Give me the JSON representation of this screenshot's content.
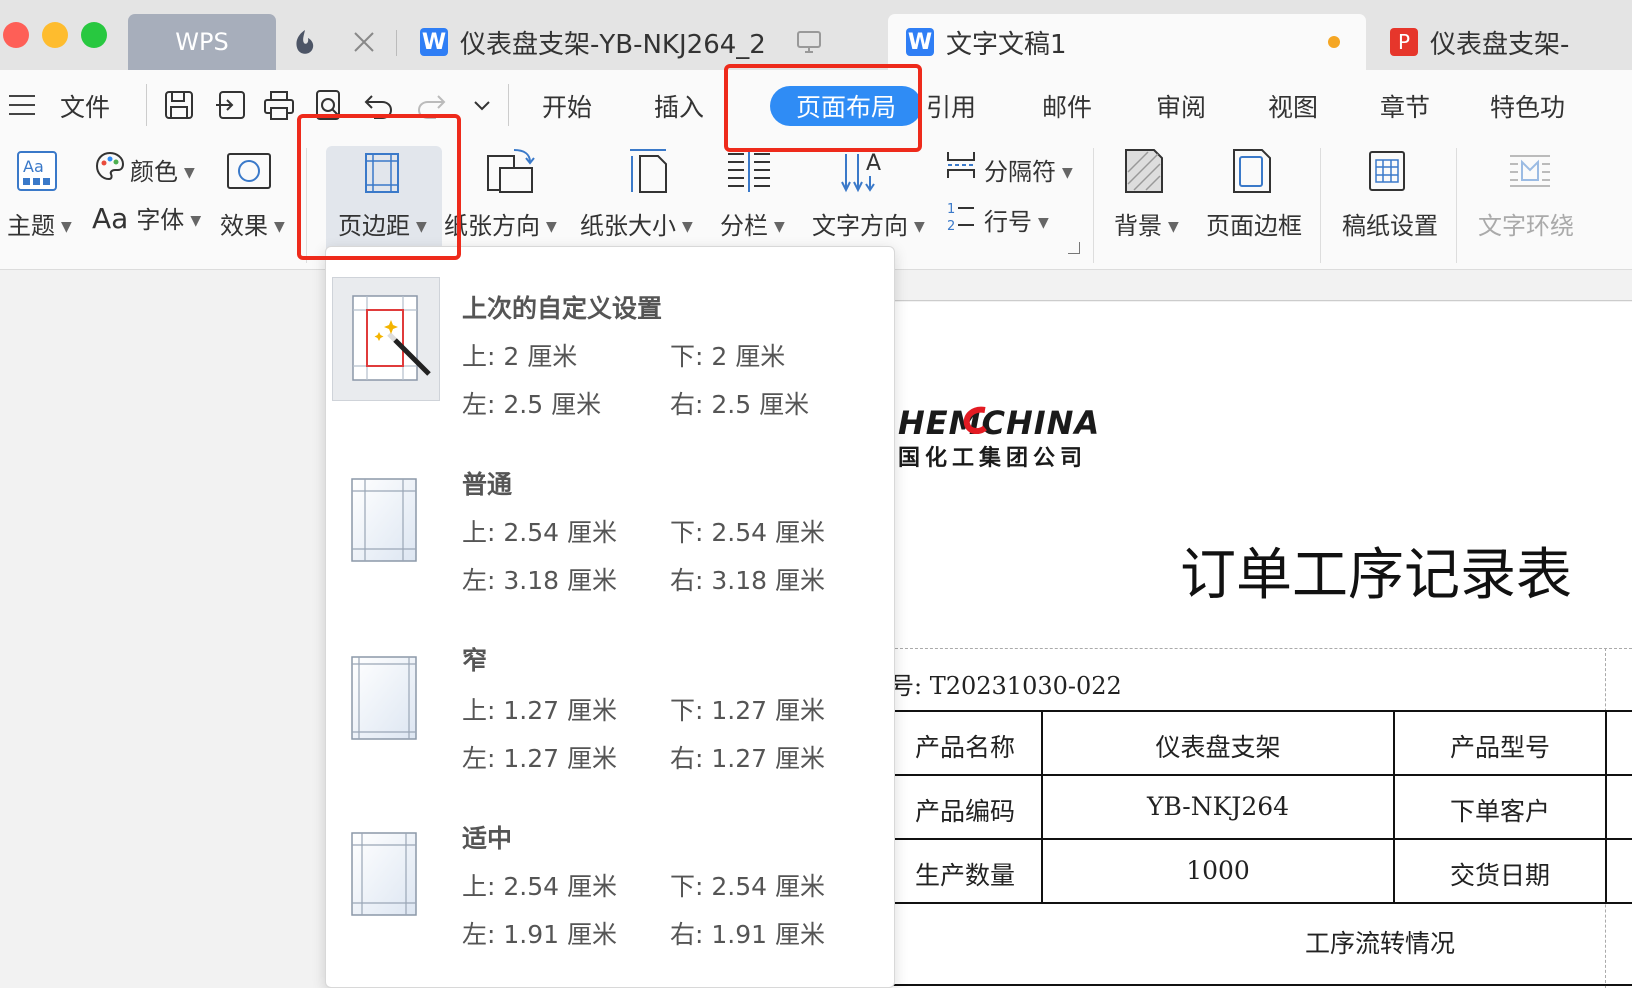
{
  "tabs": {
    "wps_label": "WPS",
    "doc1_title": "仪表盘支架-YB-NKJ264_2",
    "doc2_title": "文字文稿1",
    "doc3_title": "仪表盘支架-"
  },
  "menu": {
    "file_label": "文件",
    "items": [
      "开始",
      "插入",
      "页面布局",
      "引用",
      "邮件",
      "审阅",
      "视图",
      "章节",
      "特色功"
    ]
  },
  "ribbon": {
    "theme": "主题",
    "color": "颜色",
    "font": "字体",
    "font_prefix": "Aa",
    "effect": "效果",
    "margin": "页边距",
    "orientation": "纸张方向",
    "size": "纸张大小",
    "columns": "分栏",
    "text_direction": "文字方向",
    "separator": "分隔符",
    "line_number": "行号",
    "background": "背景",
    "page_border": "页面边框",
    "manuscript": "稿纸设置",
    "text_wrap": "文字环绕"
  },
  "margin_options": [
    {
      "name": "上次的自定义设置",
      "top": "上: 2 厘米",
      "bottom": "下: 2 厘米",
      "left": "左: 2.5 厘米",
      "right": "右: 2.5 厘米"
    },
    {
      "name": "普通",
      "top": "上: 2.54 厘米",
      "bottom": "下: 2.54 厘米",
      "left": "左: 3.18 厘米",
      "right": "右: 3.18 厘米"
    },
    {
      "name": "窄",
      "top": "上: 1.27 厘米",
      "bottom": "下: 1.27 厘米",
      "left": "左: 1.27 厘米",
      "right": "右: 1.27 厘米"
    },
    {
      "name": "适中",
      "top": "上: 2.54 厘米",
      "bottom": "下: 2.54 厘米",
      "left": "左: 1.91 厘米",
      "right": "右: 1.91 厘米"
    }
  ],
  "document": {
    "logo_text": "HEMCHINA",
    "logo_sub": "国化工集团公司",
    "title": "订单工序记录表",
    "order_no": "号:  T20231030-022",
    "table": [
      [
        "产品名称",
        "仪表盘支架",
        "产品型号"
      ],
      [
        "产品编码",
        "YB-NKJ264",
        "下单客户"
      ],
      [
        "生产数量",
        "1000",
        "交货日期"
      ]
    ],
    "process_label": "工序流转情况"
  },
  "colors": {
    "accent": "#2f8cf5",
    "highlight": "#ee2a1b"
  }
}
